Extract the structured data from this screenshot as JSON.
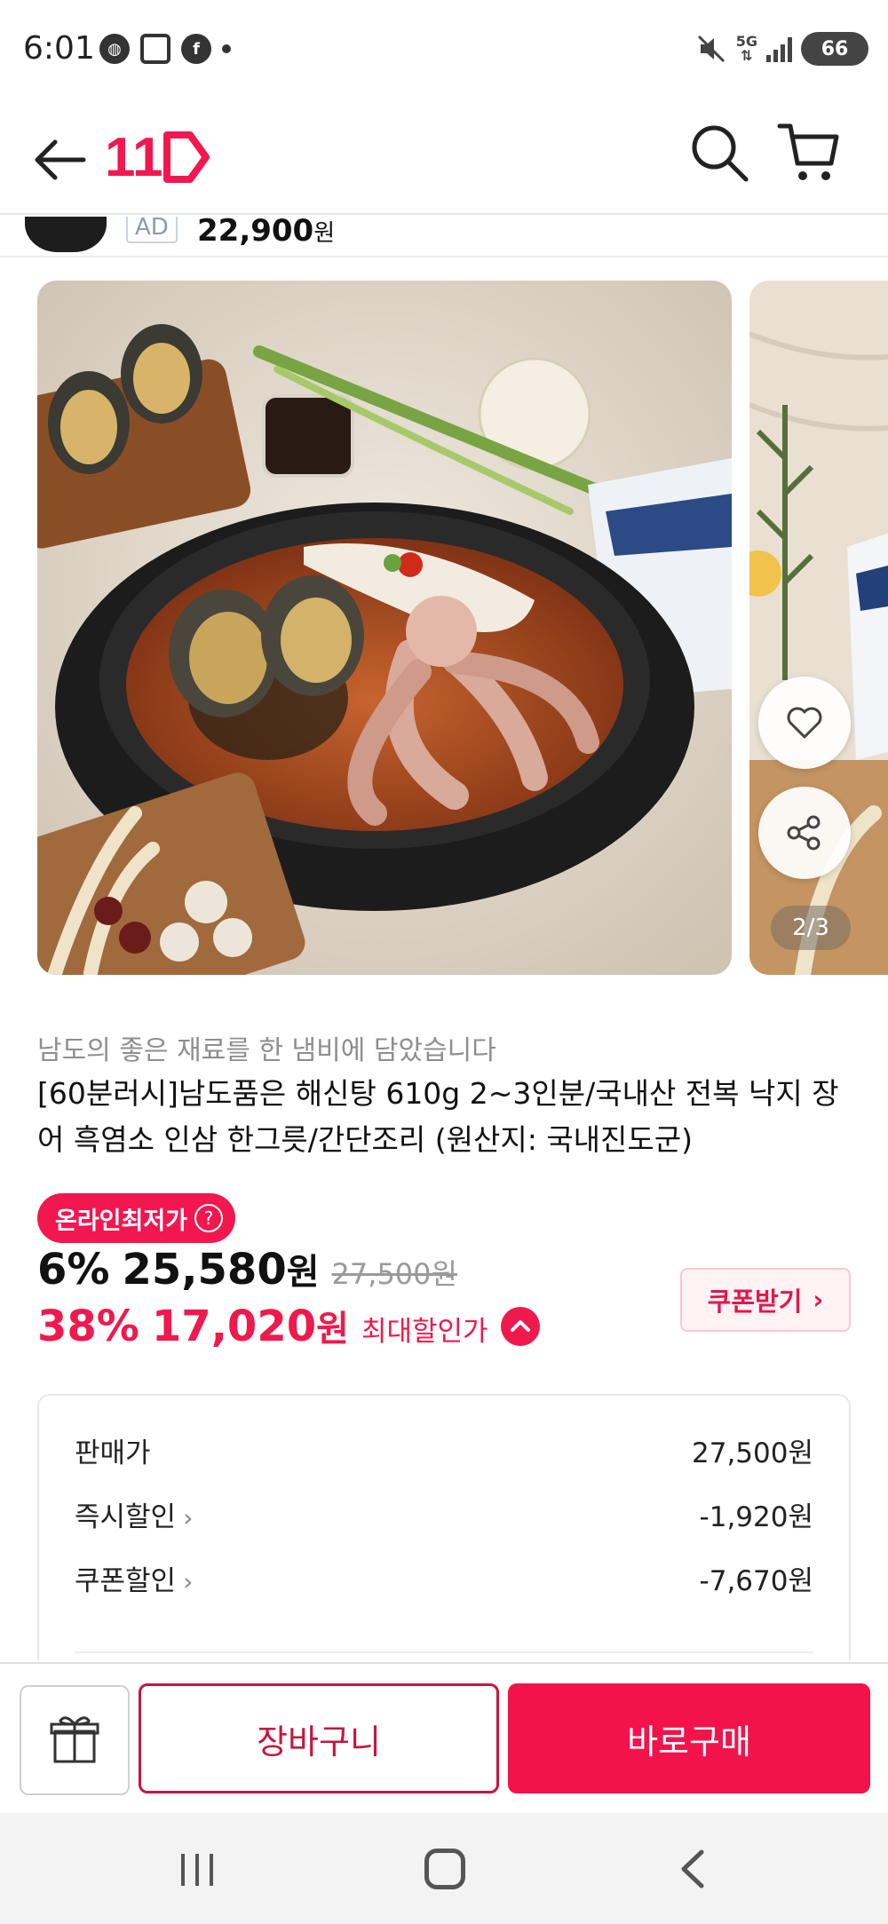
{
  "status_bar": {
    "time": "6:01",
    "network": "5G",
    "battery": "66"
  },
  "header": {
    "logo_text": "11",
    "icons": [
      "back-arrow-icon",
      "search-icon",
      "cart-icon"
    ]
  },
  "ad": {
    "badge": "AD",
    "price": "22,900",
    "price_unit": "원"
  },
  "gallery": {
    "page_indicator": "2/3",
    "icons": [
      "heart-icon",
      "share-icon"
    ]
  },
  "product": {
    "subtitle": "남도의 좋은 재료를 한 냄비에 담았습니다",
    "title": "[60분러시]남도품은 해신탕 610g 2~3인분/국내산 전복 낙지 장어 흑염소 인삼 한그릇/간단조리 (원산지: 국내진도군)",
    "lowest_badge": "온라인최저가",
    "lowest_badge_help": "?",
    "discount_rate": "6%",
    "price": "25,580",
    "price_unit": "원",
    "original_price": "27,500원",
    "max_discount_rate": "38%",
    "max_price": "17,020",
    "max_price_unit": "원",
    "max_label": "최대할인가",
    "coupon_button": "쿠폰받기",
    "coupon_chevron": "›"
  },
  "breakdown": {
    "rows": [
      {
        "label": "판매가",
        "value": "27,500원",
        "chevron": ""
      },
      {
        "label": "즉시할인",
        "value": "-1,920원",
        "chevron": "›"
      },
      {
        "label": "쿠폰할인",
        "value": "-7,670원",
        "chevron": "›"
      }
    ]
  },
  "actions": {
    "cart_button": "장바구니",
    "buy_button": "바로구매"
  },
  "colors": {
    "accent": "#f0194d",
    "buy": "#f2134b",
    "cart_border": "#c7163e"
  }
}
